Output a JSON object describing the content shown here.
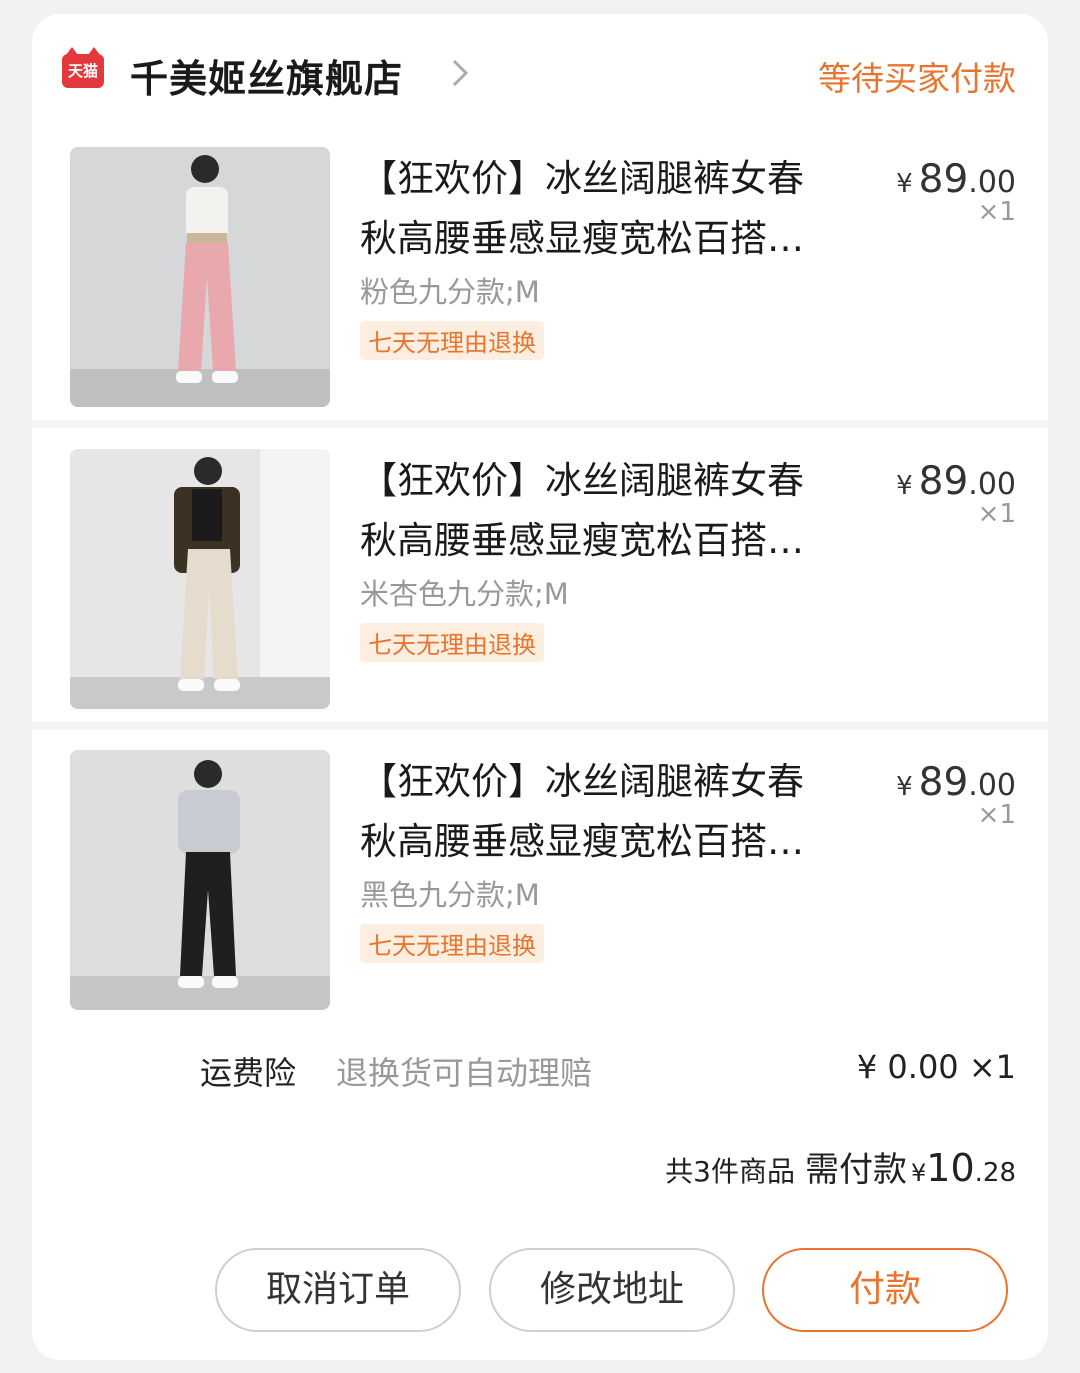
{
  "header": {
    "logo_text": "天猫",
    "shop_name": "千美姬丝旗舰店",
    "order_status": "等待买家付款"
  },
  "items": [
    {
      "title_line1": "【狂欢价】冰丝阔腿裤女春",
      "title_line2": "秋高腰垂感显瘦宽松百搭…",
      "variant": "粉色九分款;M",
      "badge": "七天无理由退换",
      "price_currency": "¥",
      "price_int": "89",
      "price_dec": ".00",
      "qty": "×1",
      "pants_color": "#e9a8ad"
    },
    {
      "title_line1": "【狂欢价】冰丝阔腿裤女春",
      "title_line2": "秋高腰垂感显瘦宽松百搭…",
      "variant": "米杏色九分款;M",
      "badge": "七天无理由退换",
      "price_currency": "¥",
      "price_int": "89",
      "price_dec": ".00",
      "qty": "×1",
      "pants_color": "#e6dccd"
    },
    {
      "title_line1": "【狂欢价】冰丝阔腿裤女春",
      "title_line2": "秋高腰垂感显瘦宽松百搭…",
      "variant": "黑色九分款;M",
      "badge": "七天无理由退换",
      "price_currency": "¥",
      "price_int": "89",
      "price_dec": ".00",
      "qty": "×1",
      "pants_color": "#1f1f1f"
    }
  ],
  "insurance": {
    "label": "运费险",
    "description": "退换货可自动理赔",
    "price": "¥ 0.00 ×1"
  },
  "summary": {
    "count_text": "共3件商品",
    "need_pay_label": "需付款",
    "currency": "¥",
    "total_int": "10",
    "total_dec": ".28"
  },
  "buttons": {
    "cancel": "取消订单",
    "address": "修改地址",
    "pay": "付款"
  },
  "colors": {
    "accent": "#e8742e",
    "tmall_red": "#e4393c"
  }
}
